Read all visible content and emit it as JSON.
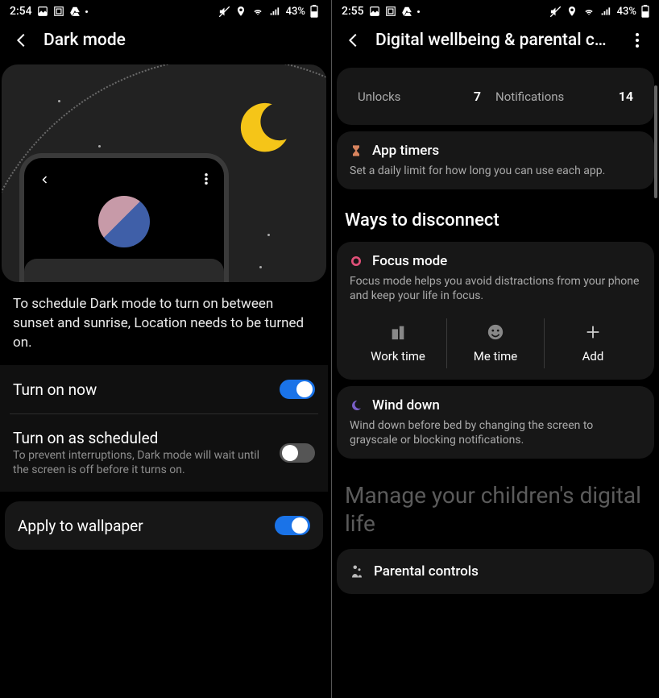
{
  "left": {
    "status": {
      "time": "2:54",
      "battery_pct": "43%"
    },
    "toolbar": {
      "title": "Dark mode"
    },
    "helper": "To schedule Dark mode to turn on between sunset and sunrise, Location needs to be turned on.",
    "rows": {
      "turn_on_now": {
        "title": "Turn on now",
        "on": true
      },
      "scheduled": {
        "title": "Turn on as scheduled",
        "sub": "To prevent interruptions, Dark mode will wait until the screen is off before it turns on.",
        "on": false
      },
      "wallpaper": {
        "title": "Apply to wallpaper",
        "on": true
      }
    }
  },
  "right": {
    "status": {
      "time": "2:55",
      "battery_pct": "43%"
    },
    "toolbar": {
      "title": "Digital wellbeing & parental con…"
    },
    "stats": {
      "unlocks_lbl": "Unlocks",
      "unlocks_val": "7",
      "notif_lbl": "Notifications",
      "notif_val": "14"
    },
    "app_timers": {
      "title": "App timers",
      "desc": "Set a daily limit for how long you can use each app."
    },
    "section1_title": "Ways to disconnect",
    "focus": {
      "title": "Focus mode",
      "desc": "Focus mode helps you avoid distractions from your phone and keep your life in focus.",
      "tiles": {
        "work": "Work time",
        "me": "Me time",
        "add": "Add"
      }
    },
    "wind": {
      "title": "Wind down",
      "desc": "Wind down before bed by changing the screen to grayscale or blocking notifications."
    },
    "section2_title": "Manage your children's digital life",
    "parental": {
      "title": "Parental controls"
    }
  }
}
